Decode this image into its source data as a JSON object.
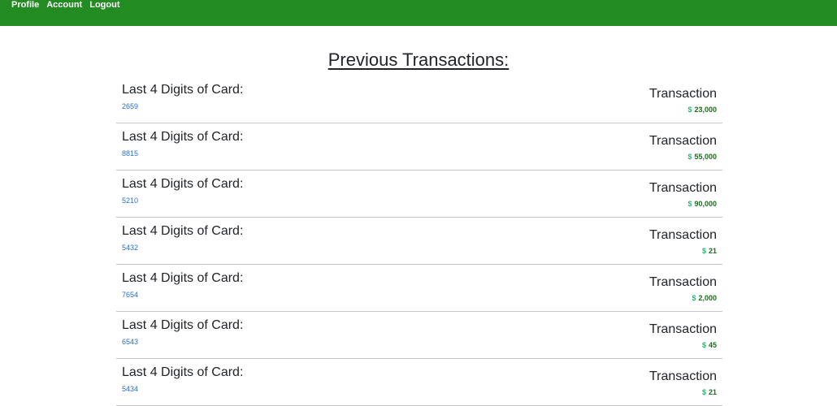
{
  "nav": {
    "items": [
      {
        "label": "Profile"
      },
      {
        "label": "Account"
      },
      {
        "label": "Logout"
      }
    ]
  },
  "page": {
    "title": "Previous Transactions:"
  },
  "transactions": [
    {
      "card_label": "Last 4 Digits of Card:",
      "card_digits": "2659",
      "tx_label": "Transaction",
      "currency": "$",
      "amount": "23,000"
    },
    {
      "card_label": "Last 4 Digits of Card:",
      "card_digits": "8815",
      "tx_label": "Transaction",
      "currency": "$",
      "amount": "55,000"
    },
    {
      "card_label": "Last 4 Digits of Card:",
      "card_digits": "5210",
      "tx_label": "Transaction",
      "currency": "$",
      "amount": "90,000"
    },
    {
      "card_label": "Last 4 Digits of Card:",
      "card_digits": "5432",
      "tx_label": "Transaction",
      "currency": "$",
      "amount": "21"
    },
    {
      "card_label": "Last 4 Digits of Card:",
      "card_digits": "7654",
      "tx_label": "Transaction",
      "currency": "$",
      "amount": "2,000"
    },
    {
      "card_label": "Last 4 Digits of Card:",
      "card_digits": "6543",
      "tx_label": "Transaction",
      "currency": "$",
      "amount": "45"
    },
    {
      "card_label": "Last 4 Digits of Card:",
      "card_digits": "5434",
      "tx_label": "Transaction",
      "currency": "$",
      "amount": "21"
    }
  ],
  "colors": {
    "navbar": "#228b22",
    "card_digits": "#2a6fc9",
    "amount": "#1e6b1e",
    "dollar_icon": "#2bb673"
  }
}
